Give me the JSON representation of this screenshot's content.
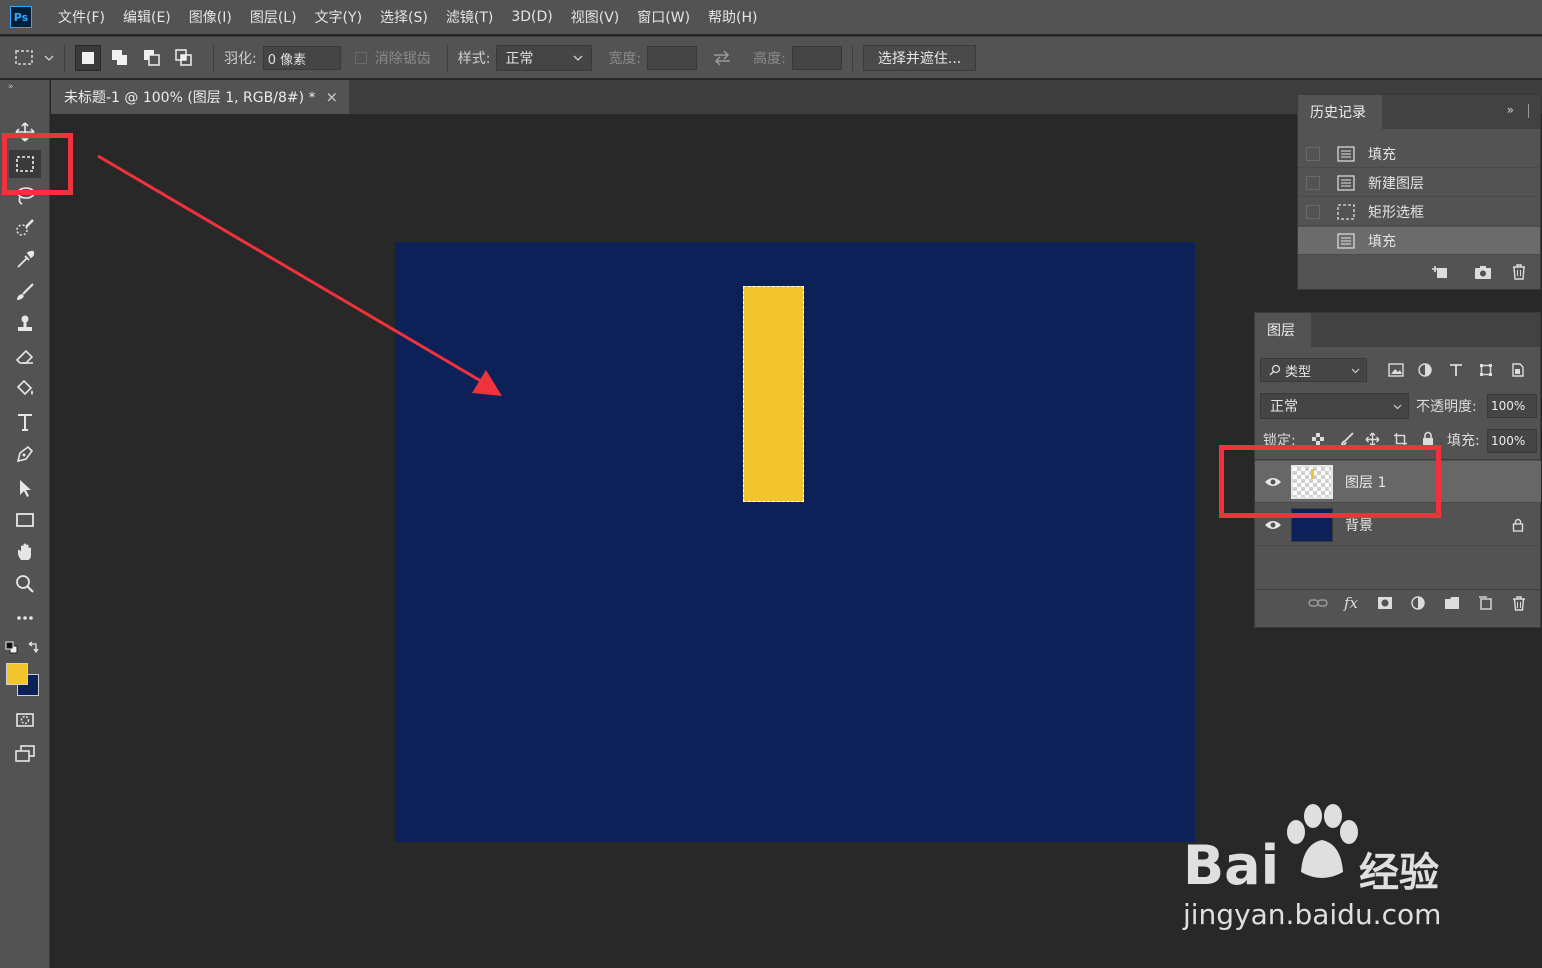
{
  "menu": {
    "logo": "Ps",
    "items": [
      "文件(F)",
      "编辑(E)",
      "图像(I)",
      "图层(L)",
      "文字(Y)",
      "选择(S)",
      "滤镜(T)",
      "3D(D)",
      "视图(V)",
      "窗口(W)",
      "帮助(H)"
    ]
  },
  "options": {
    "feather_label": "羽化:",
    "feather_value": "0 像素",
    "antialias_label": "消除锯齿",
    "style_label": "样式:",
    "style_value": "正常",
    "width_label": "宽度:",
    "height_label": "高度:",
    "select_mask_button": "选择并遮住..."
  },
  "document": {
    "tab_title": "未标题-1 @ 100% (图层 1, RGB/8#) *",
    "close": "×",
    "background_color": "#0c2157",
    "shape_color": "#f2c52d"
  },
  "colors": {
    "foreground": "#f2c52d",
    "background": "#0c2157",
    "highlight": "#f0323c"
  },
  "history": {
    "title": "历史记录",
    "items": [
      {
        "label": "填充",
        "icon": "doc-icon"
      },
      {
        "label": "新建图层",
        "icon": "doc-icon"
      },
      {
        "label": "矩形选框",
        "icon": "marquee-icon"
      },
      {
        "label": "填充",
        "icon": "doc-icon"
      }
    ]
  },
  "layers": {
    "title": "图层",
    "filter_label": "类型",
    "blend_mode": "正常",
    "opacity_label": "不透明度:",
    "opacity_value": "100%",
    "lock_label": "锁定:",
    "fill_label": "填充:",
    "fill_value": "100%",
    "items": [
      {
        "name": "图层 1",
        "selected": true
      },
      {
        "name": "背景",
        "locked": true
      }
    ]
  },
  "watermark": {
    "brand": "Bai",
    "brand_suffix": "经验",
    "url": "jingyan.baidu.com"
  }
}
